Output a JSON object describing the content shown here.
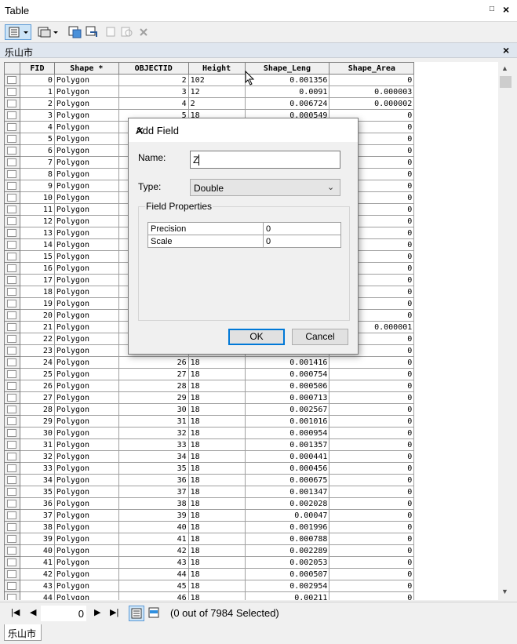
{
  "window": {
    "title": "Table"
  },
  "layer_tab": {
    "name": "乐山市"
  },
  "bottom_tab": {
    "name": "乐山市"
  },
  "table": {
    "headers": [
      "FID",
      "Shape *",
      "OBJECTID",
      "Height",
      "Shape_Leng",
      "Shape_Area"
    ],
    "rows": [
      [
        "0",
        "Polygon",
        "2",
        "102",
        "0.001356",
        "0"
      ],
      [
        "1",
        "Polygon",
        "3",
        "12",
        "0.0091",
        "0.000003"
      ],
      [
        "2",
        "Polygon",
        "4",
        "2",
        "0.006724",
        "0.000002"
      ],
      [
        "3",
        "Polygon",
        "5",
        "18",
        "0.000549",
        "0"
      ],
      [
        "4",
        "Polygon",
        "",
        "",
        "",
        "0"
      ],
      [
        "5",
        "Polygon",
        "",
        "",
        "",
        "0"
      ],
      [
        "6",
        "Polygon",
        "",
        "",
        "",
        "0"
      ],
      [
        "7",
        "Polygon",
        "",
        "",
        "",
        "0"
      ],
      [
        "8",
        "Polygon",
        "",
        "",
        "",
        "0"
      ],
      [
        "9",
        "Polygon",
        "",
        "",
        "",
        "0"
      ],
      [
        "10",
        "Polygon",
        "",
        "",
        "",
        "0"
      ],
      [
        "11",
        "Polygon",
        "",
        "",
        "",
        "0"
      ],
      [
        "12",
        "Polygon",
        "",
        "",
        "",
        "0"
      ],
      [
        "13",
        "Polygon",
        "",
        "",
        "",
        "0"
      ],
      [
        "14",
        "Polygon",
        "",
        "",
        "",
        "0"
      ],
      [
        "15",
        "Polygon",
        "",
        "",
        "",
        "0"
      ],
      [
        "16",
        "Polygon",
        "",
        "",
        "",
        "0"
      ],
      [
        "17",
        "Polygon",
        "",
        "",
        "",
        "0"
      ],
      [
        "18",
        "Polygon",
        "",
        "",
        "",
        "0"
      ],
      [
        "19",
        "Polygon",
        "",
        "",
        "",
        "0"
      ],
      [
        "20",
        "Polygon",
        "",
        "",
        "",
        "0"
      ],
      [
        "21",
        "Polygon",
        "",
        "",
        "",
        "0.000001"
      ],
      [
        "22",
        "Polygon",
        "",
        "",
        "",
        "0"
      ],
      [
        "23",
        "Polygon",
        "",
        "",
        "",
        "0"
      ],
      [
        "24",
        "Polygon",
        "26",
        "18",
        "0.001416",
        "0"
      ],
      [
        "25",
        "Polygon",
        "27",
        "18",
        "0.000754",
        "0"
      ],
      [
        "26",
        "Polygon",
        "28",
        "18",
        "0.000506",
        "0"
      ],
      [
        "27",
        "Polygon",
        "29",
        "18",
        "0.000713",
        "0"
      ],
      [
        "28",
        "Polygon",
        "30",
        "18",
        "0.002567",
        "0"
      ],
      [
        "29",
        "Polygon",
        "31",
        "18",
        "0.001016",
        "0"
      ],
      [
        "30",
        "Polygon",
        "32",
        "18",
        "0.000954",
        "0"
      ],
      [
        "31",
        "Polygon",
        "33",
        "18",
        "0.001357",
        "0"
      ],
      [
        "32",
        "Polygon",
        "34",
        "18",
        "0.000441",
        "0"
      ],
      [
        "33",
        "Polygon",
        "35",
        "18",
        "0.000456",
        "0"
      ],
      [
        "34",
        "Polygon",
        "36",
        "18",
        "0.000675",
        "0"
      ],
      [
        "35",
        "Polygon",
        "37",
        "18",
        "0.001347",
        "0"
      ],
      [
        "36",
        "Polygon",
        "38",
        "18",
        "0.002028",
        "0"
      ],
      [
        "37",
        "Polygon",
        "39",
        "18",
        "0.00047",
        "0"
      ],
      [
        "38",
        "Polygon",
        "40",
        "18",
        "0.001996",
        "0"
      ],
      [
        "39",
        "Polygon",
        "41",
        "18",
        "0.000788",
        "0"
      ],
      [
        "40",
        "Polygon",
        "42",
        "18",
        "0.002289",
        "0"
      ],
      [
        "41",
        "Polygon",
        "43",
        "18",
        "0.002053",
        "0"
      ],
      [
        "42",
        "Polygon",
        "44",
        "18",
        "0.000507",
        "0"
      ],
      [
        "43",
        "Polygon",
        "45",
        "18",
        "0.002954",
        "0"
      ],
      [
        "44",
        "Polygon",
        "46",
        "18",
        "0.00211",
        "0"
      ]
    ]
  },
  "navigation": {
    "record": "0",
    "status": "(0 out of 7984 Selected)"
  },
  "dialog": {
    "title": "Add Field",
    "name_label": "Name:",
    "name_value": "Z",
    "type_label": "Type:",
    "type_value": "Double",
    "group_label": "Field Properties",
    "properties": [
      {
        "key": "Precision",
        "value": "0"
      },
      {
        "key": "Scale",
        "value": "0"
      }
    ],
    "ok_label": "OK",
    "cancel_label": "Cancel"
  }
}
